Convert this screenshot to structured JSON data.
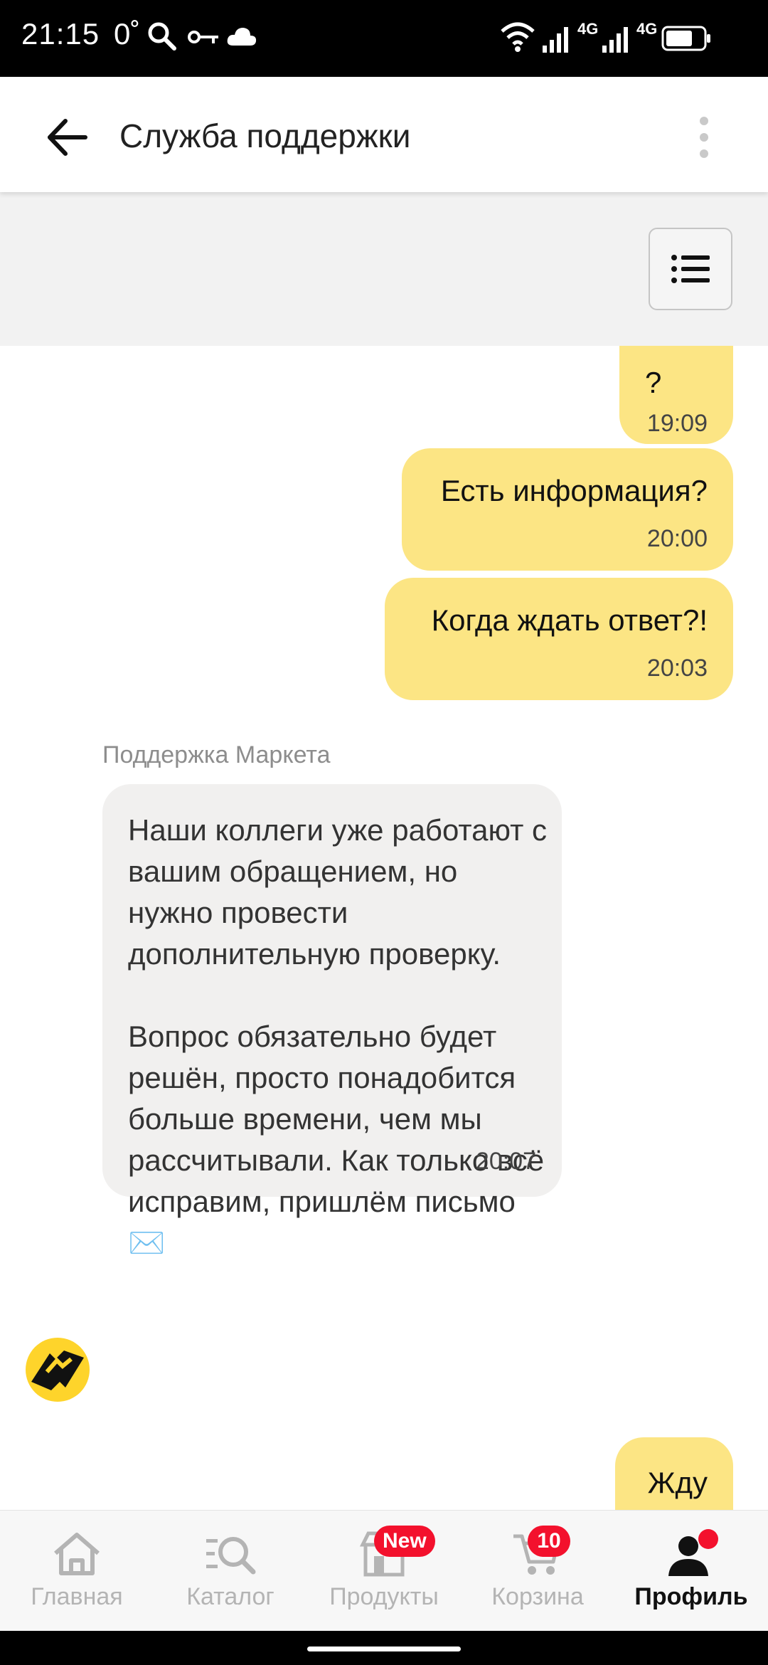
{
  "status_bar": {
    "time": "21:15",
    "temperature": "0˚",
    "signal_label_1": "4G",
    "signal_label_2": "4G"
  },
  "header": {
    "title": "Служба поддержки"
  },
  "messages": [
    {
      "from": "user",
      "text": "?",
      "time": "19:09"
    },
    {
      "from": "user",
      "text": "Есть информация?",
      "time": "20:00"
    },
    {
      "from": "user",
      "text": "Когда ждать ответ?!",
      "time": "20:03"
    },
    {
      "from": "support",
      "sender": "Поддержка Маркета",
      "text": "Наши коллеги уже работают с вашим обращением, но нужно провести дополнительную проверку.\n\nВопрос обязательно будет решён, просто понадобится больше времени, чем мы рассчитывали. Как только всё исправим, пришлём письмо ✉️",
      "time": "20:07"
    },
    {
      "from": "user",
      "text": "Жду"
    }
  ],
  "bottom_nav": {
    "items": [
      {
        "label": "Главная",
        "icon": "home-icon"
      },
      {
        "label": "Каталог",
        "icon": "catalog-search-icon"
      },
      {
        "label": "Продукты",
        "icon": "store-icon",
        "badge": "New"
      },
      {
        "label": "Корзина",
        "icon": "cart-icon",
        "badge": "10"
      },
      {
        "label": "Профиль",
        "icon": "profile-icon",
        "active": true
      }
    ]
  },
  "colors": {
    "outgoing_bubble": "#fce584",
    "incoming_bubble": "#f1f0ef",
    "badge": "#f3112d",
    "brand_yellow": "#fed42b"
  }
}
